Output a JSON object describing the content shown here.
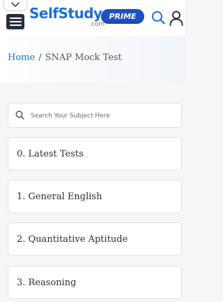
{
  "header": {
    "logo_text": "SelfStudys",
    "logo_sub": ".com",
    "badge": "PRIME",
    "colors": {
      "brand": "#1b6fd6",
      "badge": "#1f4fc4",
      "menu": "#2a2d3d"
    },
    "icons": [
      "chevron-down-icon",
      "hamburger-menu-icon",
      "search-icon",
      "user-icon"
    ]
  },
  "breadcrumb": {
    "home": "Home",
    "separator": "/",
    "current": "SNAP Mock Test"
  },
  "search": {
    "placeholder": "Search Your Subject Here"
  },
  "subjects": [
    {
      "label": "0. Latest Tests"
    },
    {
      "label": "1. General English"
    },
    {
      "label": "2. Quantitative Aptitude"
    },
    {
      "label": "3. Reasoning"
    }
  ]
}
